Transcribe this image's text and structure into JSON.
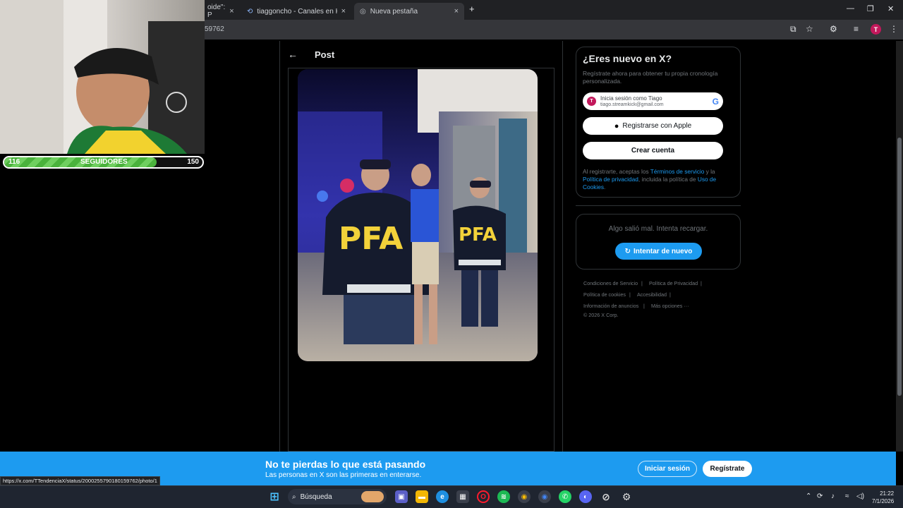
{
  "browser": {
    "tabs": [
      {
        "label": "oide\": P",
        "close": "×"
      },
      {
        "label": "tiaggoncho - Canales en Kick |",
        "close": "×"
      },
      {
        "label": "Nueva pestaña",
        "close": "×"
      }
    ],
    "new_tab": "+",
    "url": "59762",
    "profile_initial": "T"
  },
  "stream_overlay": {
    "followers_current": "116",
    "followers_label": "SEGUIDORES",
    "followers_goal": "150",
    "progress": 0.77
  },
  "post": {
    "header_title": "Post",
    "back_icon": "arrow-left-icon",
    "photo_text_left": "PFA",
    "photo_text_right": "PFA"
  },
  "signup": {
    "title": "¿Eres nuevo en X?",
    "subtitle": "Regístrate ahora para obtener tu propia cronología personalizada.",
    "google_title": "Inicia sesión como Tiago",
    "google_email": "tiago.streamkick@gmail.com",
    "google_avatar_initial": "T",
    "apple_label": "Registrarse con Apple",
    "create_label": "Crear cuenta",
    "legal_prefix": "Al registrarte, aceptas los ",
    "legal_terms": "Términos de servicio",
    "legal_mid1": " y la ",
    "legal_privacy": "Política de privacidad",
    "legal_mid2": ", incluida la política de ",
    "legal_cookies": "Uso de Cookies",
    "legal_end": "."
  },
  "error": {
    "message": "Algo salió mal. Intenta recargar.",
    "retry_label": "Intentar de nuevo"
  },
  "footer": {
    "links": [
      "Condiciones de Servicio",
      "Política de Privacidad",
      "Política de cookies",
      "Accesibilidad",
      "Información de anuncios",
      "Más opciones ···"
    ],
    "copyright": "© 2026 X Corp."
  },
  "banner": {
    "title": "No te pierdas lo que está pasando",
    "subtitle": "Las personas en X son las primeras en enterarse.",
    "login_label": "Iniciar sesión",
    "signup_label": "Regístrate"
  },
  "status_url": "https://x.com/TTendenciaX/status/2000255790180159762/photo/1",
  "taskbar": {
    "search_label": "Búsqueda",
    "time": "21:22",
    "date": "7/1/2026"
  },
  "colors": {
    "accent": "#1d9bf0",
    "progress_green": "#4ab23c",
    "background": "#000000"
  }
}
